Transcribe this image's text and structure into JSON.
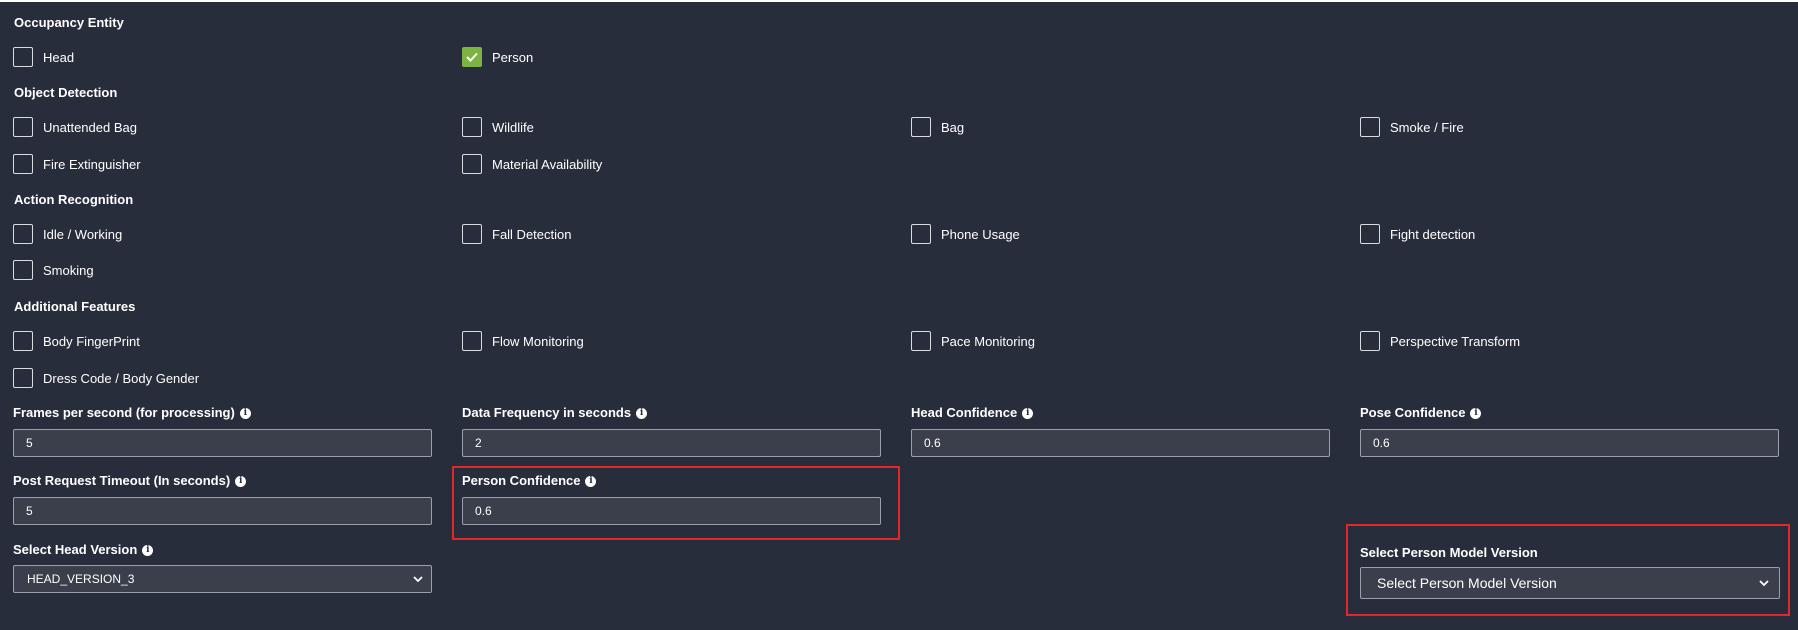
{
  "sections": {
    "occupancy": "Occupancy Entity",
    "object_detection": "Object Detection",
    "action_recognition": "Action Recognition",
    "additional_features": "Additional Features"
  },
  "checkboxes": {
    "head": {
      "label": "Head",
      "checked": false
    },
    "person": {
      "label": "Person",
      "checked": true
    },
    "unattended_bag": {
      "label": "Unattended Bag",
      "checked": false
    },
    "wildlife": {
      "label": "Wildlife",
      "checked": false
    },
    "bag": {
      "label": "Bag",
      "checked": false
    },
    "smoke_fire": {
      "label": "Smoke / Fire",
      "checked": false
    },
    "fire_extinguisher": {
      "label": "Fire Extinguisher",
      "checked": false
    },
    "material_availability": {
      "label": "Material Availability",
      "checked": false
    },
    "idle_working": {
      "label": "Idle / Working",
      "checked": false
    },
    "fall_detection": {
      "label": "Fall Detection",
      "checked": false
    },
    "phone_usage": {
      "label": "Phone Usage",
      "checked": false
    },
    "fight_detection": {
      "label": "Fight detection",
      "checked": false
    },
    "smoking": {
      "label": "Smoking",
      "checked": false
    },
    "body_fingerprint": {
      "label": "Body FingerPrint",
      "checked": false
    },
    "flow_monitoring": {
      "label": "Flow Monitoring",
      "checked": false
    },
    "pace_monitoring": {
      "label": "Pace Monitoring",
      "checked": false
    },
    "perspective_transform": {
      "label": "Perspective Transform",
      "checked": false
    },
    "dress_code": {
      "label": "Dress Code / Body Gender",
      "checked": false
    }
  },
  "fields": {
    "fps": {
      "label": "Frames per second (for processing)",
      "value": "5"
    },
    "data_frequency": {
      "label": "Data Frequency in seconds",
      "value": "2"
    },
    "head_confidence": {
      "label": "Head Confidence",
      "value": "0.6"
    },
    "pose_confidence": {
      "label": "Pose Confidence",
      "value": "0.6"
    },
    "post_timeout": {
      "label": "Post Request Timeout (In seconds)",
      "value": "5"
    },
    "person_confidence": {
      "label": "Person Confidence",
      "value": "0.6"
    }
  },
  "selects": {
    "head_version": {
      "label": "Select Head Version",
      "value": "HEAD_VERSION_3"
    },
    "person_model_version": {
      "label": "Select Person Model Version",
      "value": "Select Person Model Version"
    }
  },
  "icons": {
    "info": "info-icon",
    "check": "check-icon",
    "chevron": "chevron-down-icon"
  },
  "colors": {
    "background": "#272d3b",
    "input_bg": "#3a3f4b",
    "checked": "#7cb342",
    "highlight": "#e02828"
  }
}
